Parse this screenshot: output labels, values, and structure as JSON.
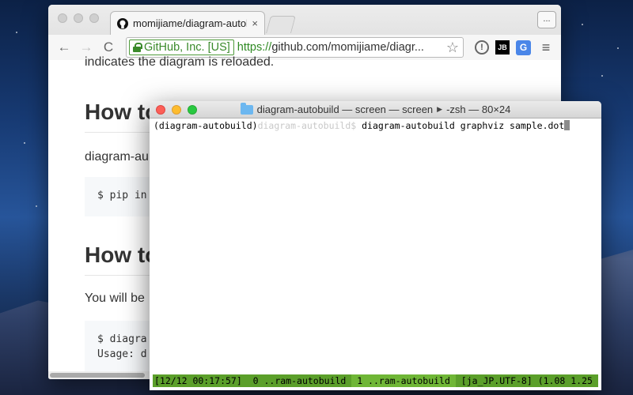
{
  "browser": {
    "tab": {
      "title": "momijiame/diagram-autobuil",
      "close": "×"
    },
    "menu_button": "...",
    "nav": {
      "back": "←",
      "forward": "→",
      "reload": "C"
    },
    "address": {
      "ev_label": "GitHub, Inc. [US]",
      "protocol": "https://",
      "rest": "github.com/momijiame/diagr..."
    },
    "extensions": {
      "info": "!",
      "jb": "JB",
      "translate": "G",
      "menu": "≡"
    }
  },
  "page": {
    "cut_text": "indicates the diagram is reloaded.",
    "heading1": "How to",
    "para1": "diagram-au",
    "code1": "$ pip in",
    "heading2": "How to",
    "para2": "You will be",
    "code2_line1": "$ diagra",
    "code2_line2": "Usage: d"
  },
  "terminal": {
    "title": "diagram-autobuild — screen — screen",
    "title_tail": "-zsh — 80×24",
    "prompt_env": "(diagram-autobuild)",
    "prompt_dir": "diagram-autobuild$",
    "command": " diagram-autobuild graphviz sample.dot",
    "status": {
      "time": "[12/12 00:17:57]",
      "win0": " 0 ..ram-autobuild ",
      "win1": " 1 ..ram-autobuild ",
      "locale": " [ja_JP.UTF-8] ",
      "load": "(1.08 1.25"
    }
  }
}
